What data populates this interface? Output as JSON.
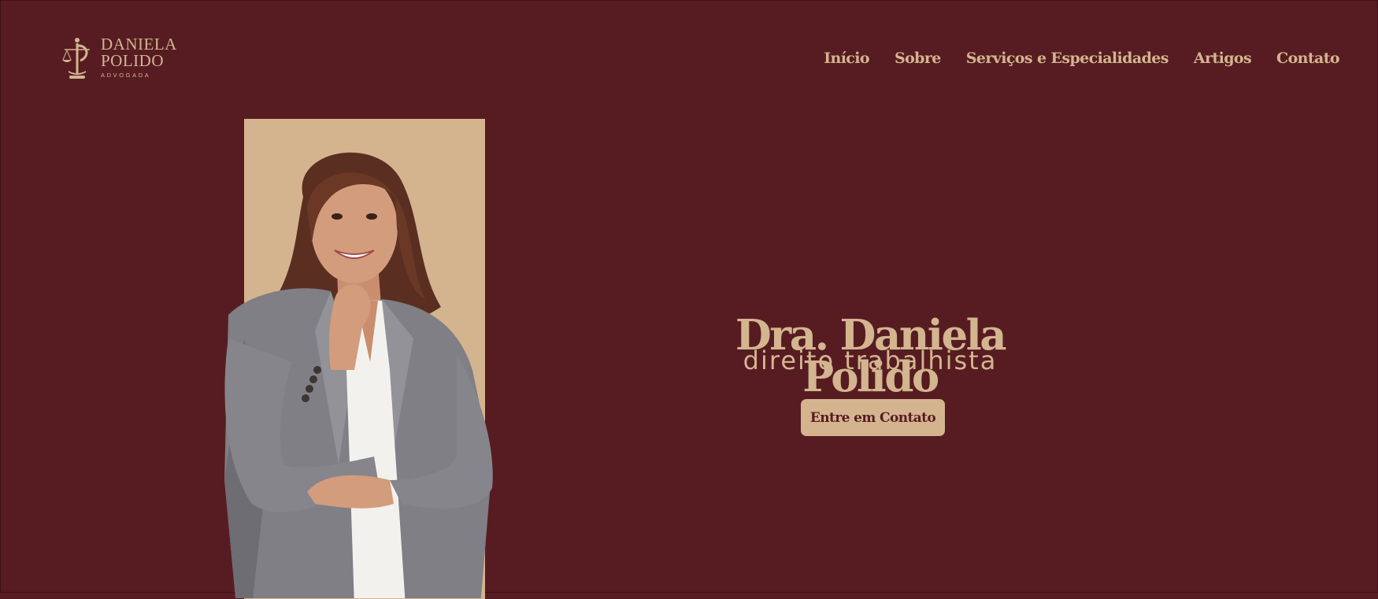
{
  "brand": {
    "name_line1": "DANIELA",
    "name_line2": "POLIDO",
    "tagline": "ADVOGADA",
    "logo_icon": "scales-of-justice-icon"
  },
  "nav": {
    "items": [
      {
        "label": "Início"
      },
      {
        "label": "Sobre"
      },
      {
        "label": "Serviços e Especialidades"
      },
      {
        "label": "Artigos"
      },
      {
        "label": "Contato"
      }
    ]
  },
  "hero": {
    "title": "Dra. Daniela Polido",
    "subtitle": "direito trabalhista",
    "cta_label": "Entre em Contato"
  },
  "colors": {
    "background": "#571c22",
    "accent": "#d3b58f",
    "button_bg": "#d4b48e"
  }
}
